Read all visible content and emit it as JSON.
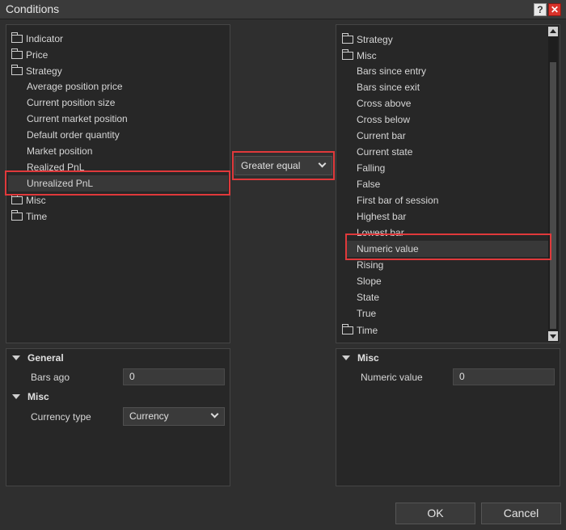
{
  "window": {
    "title": "Conditions",
    "help_label": "?",
    "close_label": "✕"
  },
  "left_tree": {
    "folders": [
      "Indicator",
      "Price",
      "Strategy"
    ],
    "strategy_items": [
      "Average position price",
      "Current position size",
      "Current market position",
      "Default order quantity",
      "Market position",
      "Realized PnL",
      "Unrealized PnL"
    ],
    "folders_after": [
      "Misc",
      "Time"
    ]
  },
  "operator": {
    "value": "Greater equal"
  },
  "right_tree": {
    "folders": [
      "Strategy",
      "Misc"
    ],
    "misc_items": [
      "Bars since entry",
      "Bars since exit",
      "Cross above",
      "Cross below",
      "Current bar",
      "Current state",
      "Falling",
      "False",
      "First bar of session",
      "Highest bar",
      "Lowest bar",
      "Numeric value",
      "Rising",
      "Slope",
      "State",
      "True"
    ],
    "folders_after": [
      "Time"
    ]
  },
  "left_props": {
    "general_label": "General",
    "bars_ago_label": "Bars ago",
    "bars_ago_value": "0",
    "misc_label": "Misc",
    "currency_type_label": "Currency type",
    "currency_type_value": "Currency"
  },
  "right_props": {
    "misc_label": "Misc",
    "numeric_value_label": "Numeric value",
    "numeric_value_value": "0"
  },
  "buttons": {
    "ok": "OK",
    "cancel": "Cancel"
  },
  "colors": {
    "highlight": "#e0393b",
    "close": "#d9322a"
  }
}
